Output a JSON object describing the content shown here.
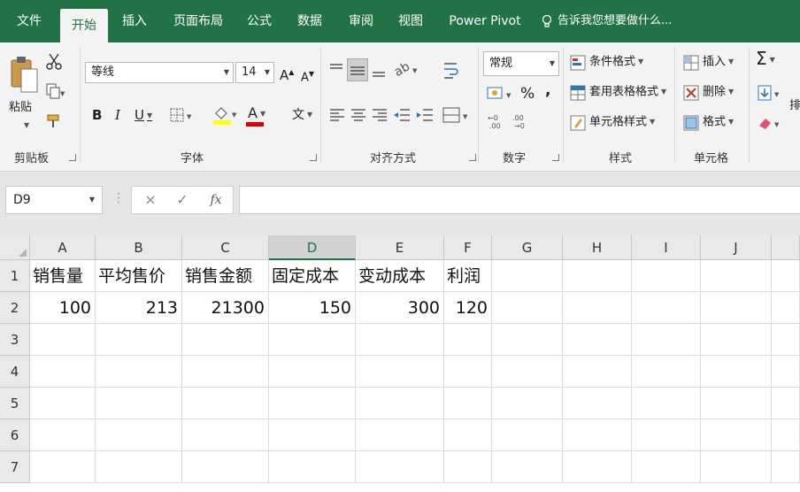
{
  "tabs": [
    {
      "name": "tab-file",
      "label": "文件",
      "active": false
    },
    {
      "name": "tab-home",
      "label": "开始",
      "active": true
    },
    {
      "name": "tab-insert",
      "label": "插入",
      "active": false
    },
    {
      "name": "tab-page-layout",
      "label": "页面布局",
      "active": false
    },
    {
      "name": "tab-formulas",
      "label": "公式",
      "active": false
    },
    {
      "name": "tab-data",
      "label": "数据",
      "active": false
    },
    {
      "name": "tab-review",
      "label": "审阅",
      "active": false
    },
    {
      "name": "tab-view",
      "label": "视图",
      "active": false
    },
    {
      "name": "tab-power-pivot",
      "label": "Power Pivot",
      "active": false
    }
  ],
  "tell_me": "告诉我您想要做什么...",
  "ribbon": {
    "clipboard": {
      "paste_label": "粘贴",
      "group_label": "剪贴板"
    },
    "font": {
      "font_name": "等线",
      "font_size": "14",
      "bold": "B",
      "italic": "I",
      "underline": "U",
      "grow": "A",
      "shrink": "A",
      "phonetic": "文",
      "font_color_glyph": "A",
      "group_label": "字体"
    },
    "alignment": {
      "group_label": "对齐方式"
    },
    "number": {
      "format": "常规",
      "percent": "%",
      "comma": ",",
      "group_label": "数字"
    },
    "styles": {
      "conditional": "条件格式",
      "table": "套用表格格式",
      "cell_styles": "单元格样式",
      "group_label": "样式"
    },
    "cells": {
      "insert": "插入",
      "delete": "删除",
      "format": "格式",
      "group_label": "单元格"
    },
    "editing": {
      "sum": "Σ",
      "overflow": "排"
    }
  },
  "formula_bar": {
    "name_box": "D9",
    "cancel": "×",
    "enter": "✓",
    "fx": "fx",
    "formula": ""
  },
  "sheet": {
    "columns": [
      "A",
      "B",
      "C",
      "D",
      "E",
      "F",
      "G",
      "H",
      "I",
      "J"
    ],
    "selected_column": "D",
    "rows": [
      "1",
      "2",
      "3",
      "4",
      "5",
      "6",
      "7"
    ],
    "headers": [
      "销售量",
      "平均售价",
      "销售金额",
      "固定成本",
      "变动成本",
      "利润"
    ],
    "values": [
      "100",
      "213",
      "21300",
      "150",
      "300",
      "120"
    ]
  },
  "colors": {
    "accent": "#217346",
    "ribbon_bg": "#f3f3f3",
    "highlight_yellow": "#ffff00",
    "font_red": "#e00000"
  }
}
